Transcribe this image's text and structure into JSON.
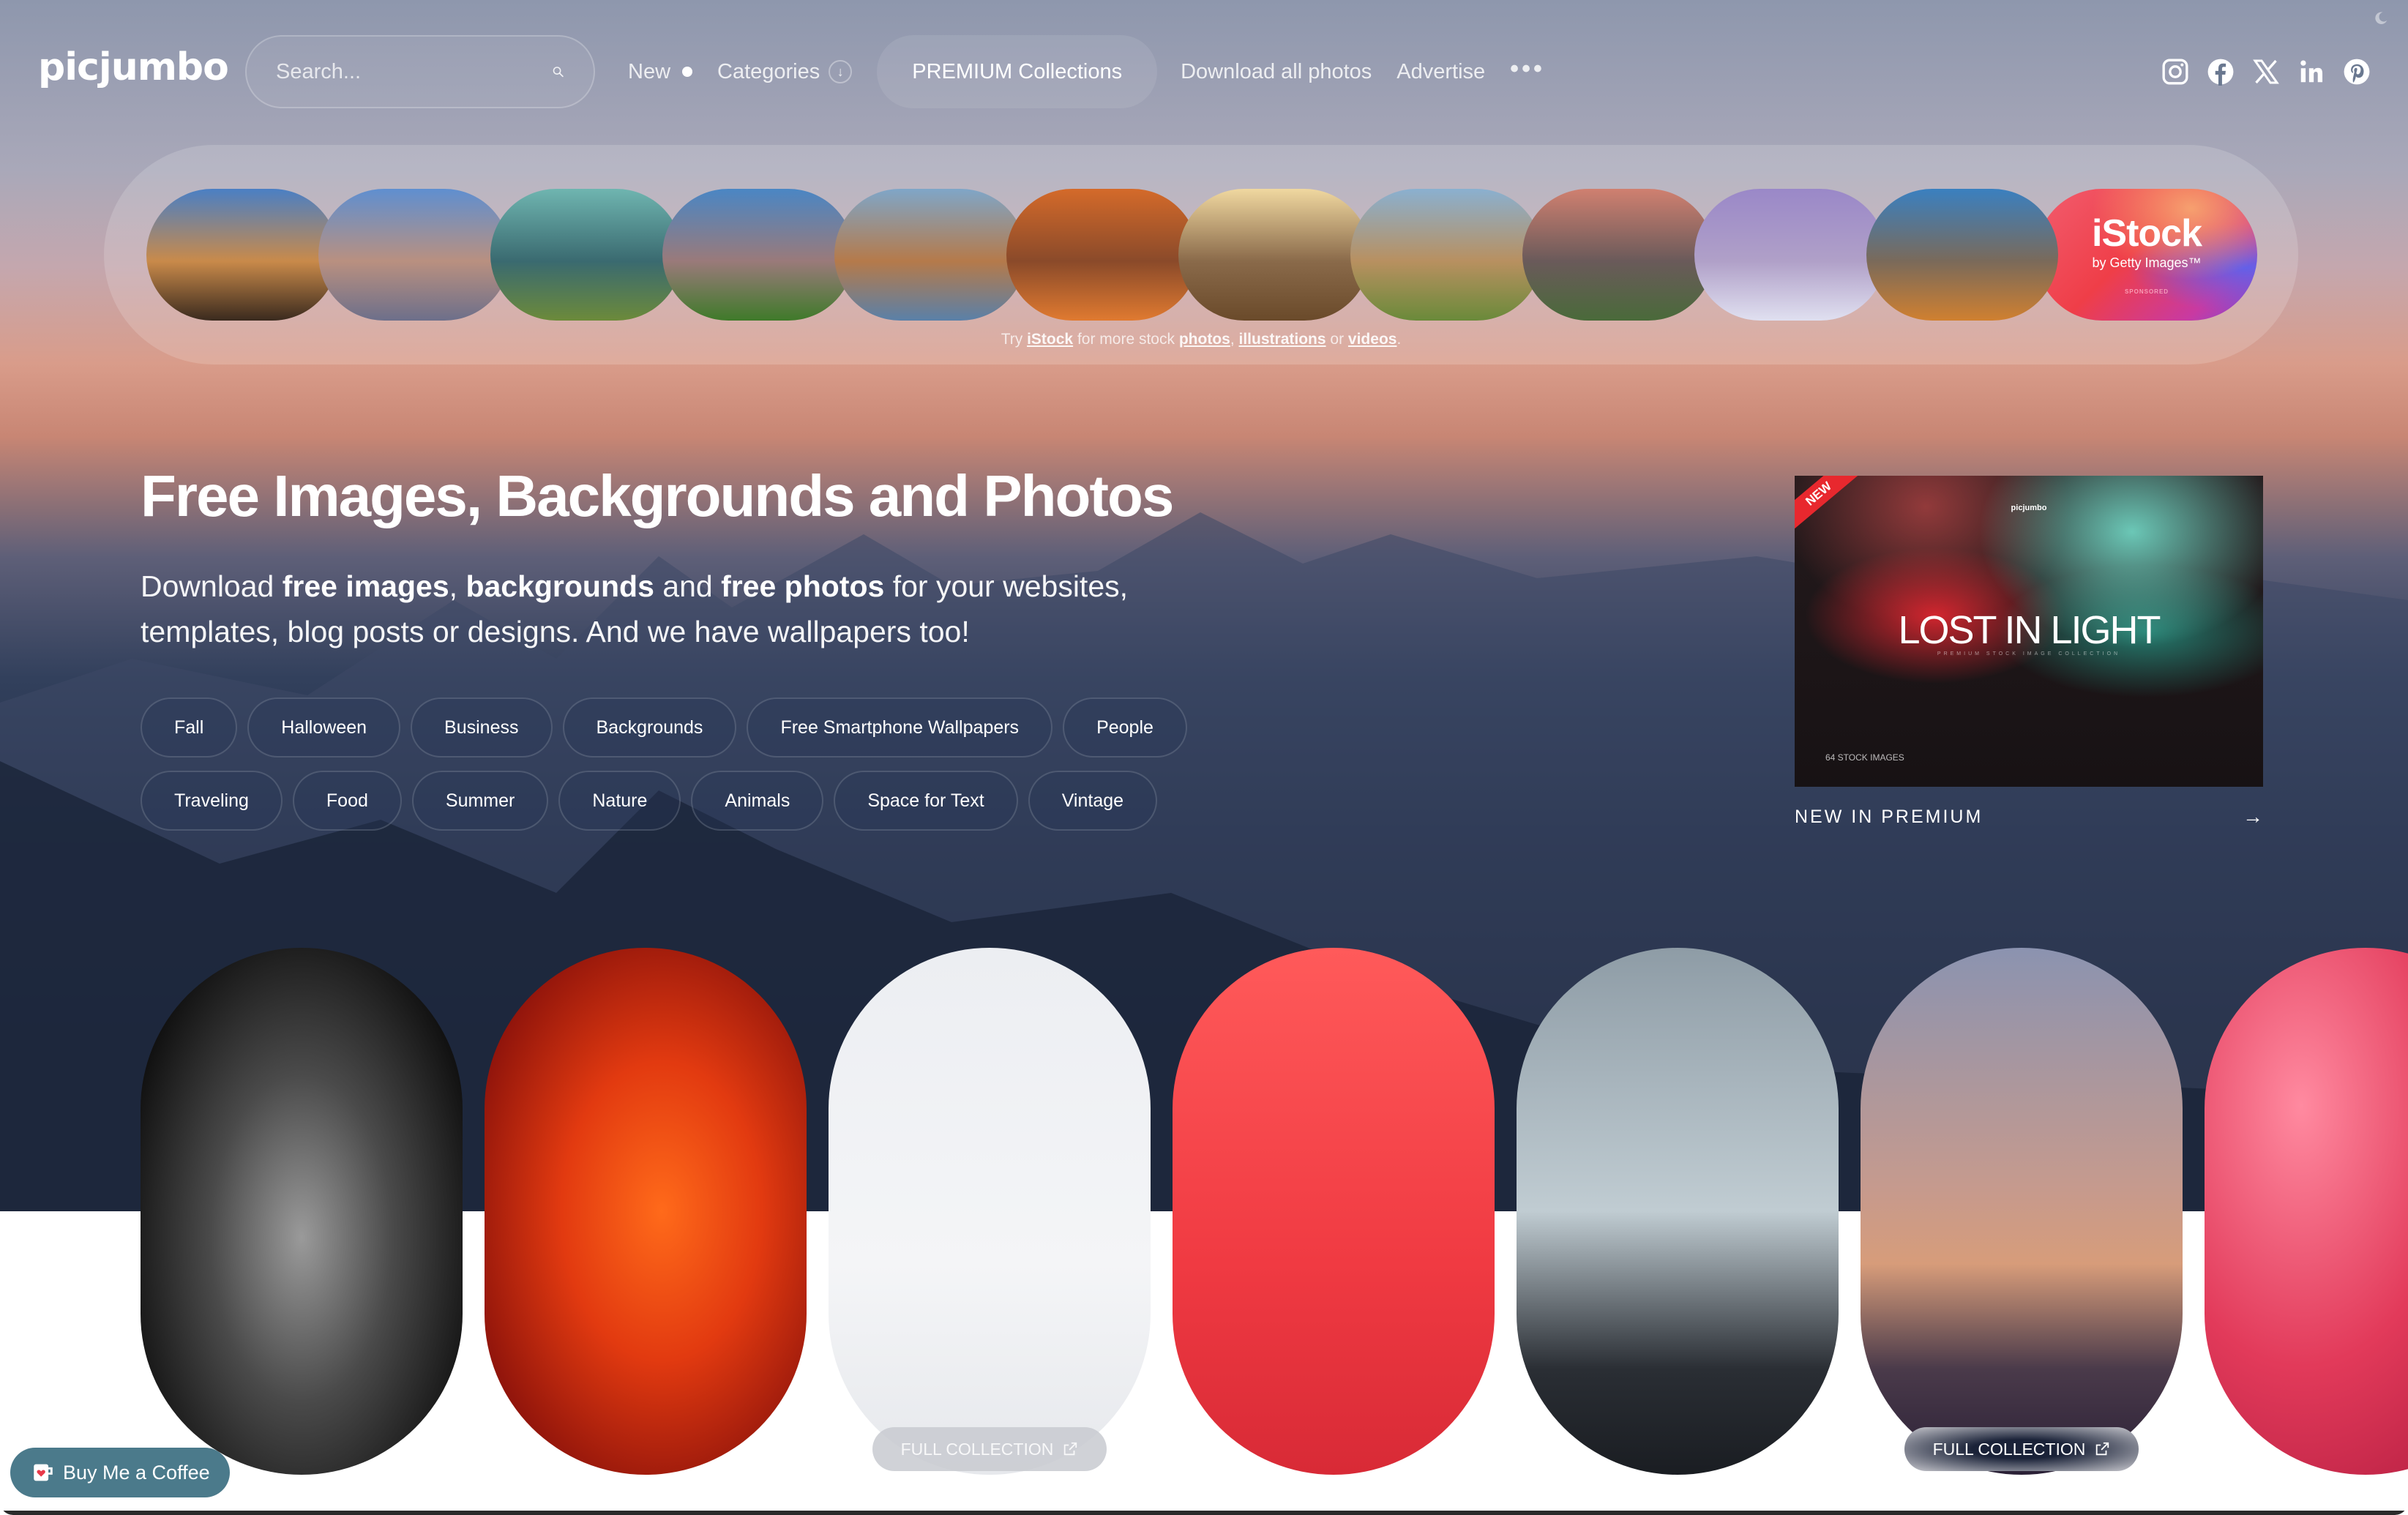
{
  "header": {
    "logo": "picjumbo",
    "search_placeholder": "Search...",
    "nav": {
      "new": "New",
      "categories": "Categories",
      "premium": "PREMIUM Collections",
      "download_all": "Download all photos",
      "advertise": "Advertise",
      "more": "•••"
    },
    "social": [
      "instagram",
      "facebook",
      "x",
      "linkedin",
      "pinterest"
    ]
  },
  "strip": {
    "thumbnails": [
      {
        "name": "dolomites-sunset-1",
        "colors": [
          "#4a7fc4",
          "#c98a4a",
          "#3a2a1e"
        ]
      },
      {
        "name": "dolomites-peaks-2",
        "colors": [
          "#5f8fd0",
          "#b99080",
          "#6d6f8a"
        ]
      },
      {
        "name": "dolomites-valley-3",
        "colors": [
          "#6fb5b0",
          "#3a6a70",
          "#6c8a3a"
        ]
      },
      {
        "name": "dolomites-green-4",
        "colors": [
          "#4a86c4",
          "#9a7a7a",
          "#3f7a2a"
        ]
      },
      {
        "name": "dolomites-lake-5",
        "colors": [
          "#7fa6c8",
          "#b57a4a",
          "#5a80a8"
        ]
      },
      {
        "name": "dolomites-orange-6",
        "colors": [
          "#d46a2a",
          "#8a4a2a",
          "#e07a30"
        ]
      },
      {
        "name": "dolomites-sunburst-7",
        "colors": [
          "#f0d8a0",
          "#8a6a4a",
          "#6a4a2a"
        ]
      },
      {
        "name": "dolomites-meadow-8",
        "colors": [
          "#8ab0d0",
          "#b89060",
          "#6a8a3a"
        ]
      },
      {
        "name": "dolomites-church-9",
        "colors": [
          "#d08070",
          "#6a5a5a",
          "#4a6a3a"
        ]
      },
      {
        "name": "dolomites-snow-10",
        "colors": [
          "#9a88c8",
          "#b0a0c8",
          "#e0e0f0"
        ]
      },
      {
        "name": "dolomites-autumn-11",
        "colors": [
          "#3a80c0",
          "#7a6a5a",
          "#d08030"
        ]
      }
    ],
    "istock": {
      "brand": "iStock",
      "sub": "by Getty Images™",
      "sponsored": "SPONSORED"
    },
    "note": {
      "try": "Try",
      "istock": "iStock",
      "mid": "for more stock",
      "photos": "photos",
      "comma": ",",
      "illustrations": "illustrations",
      "or": "or",
      "videos": "videos",
      "end": "."
    }
  },
  "hero": {
    "title": "Free Images, Backgrounds and Photos",
    "sub": {
      "t1": "Download ",
      "b1": "free images",
      "t2": ", ",
      "b2": "backgrounds",
      "t3": " and ",
      "b3": "free photos",
      "t4": " for your websites, templates, blog posts or designs. And we have wallpapers too!"
    },
    "tags_row1": [
      "Fall",
      "Halloween",
      "Business",
      "Backgrounds",
      "Free Smartphone Wallpapers",
      "People"
    ],
    "tags_row2": [
      "Traveling",
      "Food",
      "Summer",
      "Nature",
      "Animals",
      "Space for Text",
      "Vintage"
    ]
  },
  "premium_card": {
    "badge": "NEW",
    "logo": "picjumbo",
    "title": "LOST IN LIGHT",
    "tagline": "PREMIUM STOCK IMAGE COLLECTION",
    "count": "64 STOCK IMAGES",
    "label": "NEW IN PREMIUM",
    "arrow": "→"
  },
  "gallery": {
    "items": [
      {
        "name": "lion-bw",
        "bg": "radial-gradient(ellipse at 50% 55%, #9a9a9a 0%, #4a4a4a 40%, #111 80%)"
      },
      {
        "name": "woman-silhouette-orange",
        "bg": "radial-gradient(ellipse at 55% 50%, #ff6a1a 0%, #e23a10 40%, #7a0a0a 90%)"
      },
      {
        "name": "phone-in-hand",
        "bg": "linear-gradient(180deg, #eceef2 0%, #f4f5f7 60%, #e6e8ec 100%)"
      },
      {
        "name": "camera-lens-red",
        "bg": "linear-gradient(180deg, #ff5a5a 0%, #f03a42 60%, #d82a36 100%)"
      },
      {
        "name": "desert-dunes",
        "bg": "linear-gradient(180deg, #8e9ca6 0%, #c0ccd2 50%, #2a2e34 80%, #1a1d22 100%)"
      },
      {
        "name": "dubai-skyline",
        "bg": "linear-gradient(180deg, #8b93b0 0%, #c59a8e 45%, #d79c7a 60%, #4a3a4a 80%, #2a2036 100%)"
      },
      {
        "name": "flamingo",
        "bg": "radial-gradient(ellipse at 30% 30%, #ff8aa0 0%, #e23a5a 50%, #a8163a 100%)"
      }
    ],
    "full_collection": "FULL COLLECTION"
  },
  "buy_coffee": "Buy Me a Coffee"
}
